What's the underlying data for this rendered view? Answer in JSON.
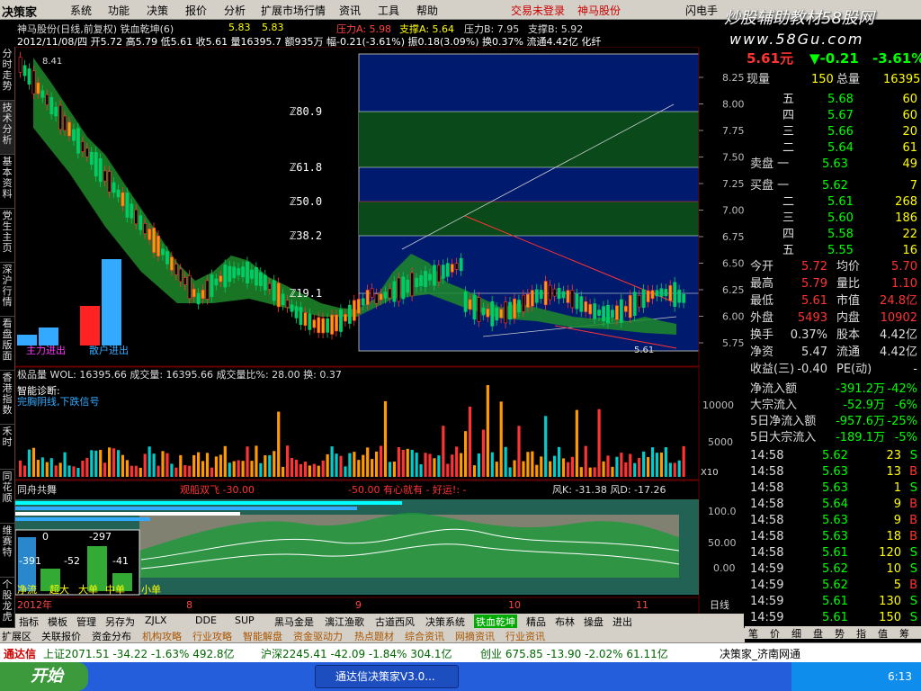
{
  "menubar": {
    "logo": "决策家",
    "items": [
      "系统",
      "功能",
      "决策",
      "报价",
      "分析",
      "扩展市场行情",
      "资讯",
      "工具",
      "帮助"
    ],
    "alert1": "交易未登录",
    "alert2": "神马股份",
    "right": "闪电手"
  },
  "watermark": {
    "line1": "炒股辅助教材58股网",
    "line2": "www.58Gu.com"
  },
  "side_tabs": [
    "分时走势",
    "技术分析",
    "基本资料",
    "党生主页",
    "深沪行情",
    "看盘版面",
    "香港指数",
    "禾时",
    "同花顺",
    "维赛特",
    "个股龙虎"
  ],
  "header": {
    "title": "神马股份(日线,前复权) 铁血乾坤(6)",
    "t1": "5.83",
    "t2": "5.83",
    "pressure": "压力A: 5.98",
    "support": "支撑A: 5.64",
    "pressure2": "压力B: 7.95",
    "support2": "支撑B: 5.92",
    "line2": "2012/11/08/四 开5.72 高5.79 低5.61 收5.61 量16395.7 额935万 幅-0.21(-3.61%) 振0.18(3.09%) 换0.37% 流通4.42亿 化纤"
  },
  "main_chart": {
    "price_top": "8.41",
    "price_last": "5.61",
    "fib": [
      "ℤ80.9",
      "ℤ61.8",
      "ℤ50.0",
      "ℤ38.2",
      "ℤ19.1"
    ],
    "y_ticks": [
      "8.25",
      "8.00",
      "7.75",
      "7.50",
      "7.25",
      "7.00",
      "6.75",
      "6.50",
      "6.25",
      "6.00",
      "5.75"
    ],
    "main_in": "主力进出",
    "retail_in": "散户进出"
  },
  "volume": {
    "label": "极品量 WOL: 16395.66   成交量: 16395.66   成交量比%: 28.00 换: 0.37",
    "label2": "智能诊断:",
    "label3": "完胸阴线,下跌信号",
    "y_ticks": [
      "10000",
      "5000"
    ],
    "x10": "X10"
  },
  "osc": {
    "title": "同舟共舞",
    "mid": "观船双飞 -30.00",
    "mid2": "-50.00  有心就有 - 好运!: -",
    "right": "风K: -31.38 风D: -17.26",
    "y_ticks": [
      "100.0",
      "50.00",
      "0.00"
    ],
    "box_vals": [
      "0",
      "-297",
      "-391",
      "-52",
      "-41"
    ],
    "box_labels": [
      "净流",
      "超大",
      "大单",
      "中单",
      "小单"
    ]
  },
  "x_axis": {
    "labels": [
      "2012年",
      "8",
      "9",
      "10",
      "11"
    ],
    "right": "日线"
  },
  "bottom_tabs": [
    "指标",
    "模板",
    "管理",
    "另存为",
    "ZJLX",
    "DDE",
    "SUP",
    "黑马金是",
    "漓江渔歌",
    "古道西风",
    "决策系统",
    "铁血乾坤",
    "精品",
    "布林",
    "操盘",
    "进出"
  ],
  "tabs2": [
    "扩展区",
    "关联报价",
    "资金分布",
    "机构攻略",
    "行业攻略",
    "智能解盘",
    "资金驱动力",
    "热点题材",
    "综合资讯",
    "网摘资讯",
    "行业资讯"
  ],
  "quote": {
    "price": "5.61元",
    "chg": "▼-0.21",
    "pct": "-3.61%",
    "now_label": "现量",
    "now_val": "150",
    "total_label": "总量",
    "total_val": "16395",
    "asks": [
      [
        "五",
        "5.68",
        "60"
      ],
      [
        "四",
        "5.67",
        "60"
      ],
      [
        "三",
        "5.66",
        "20"
      ],
      [
        "二",
        "5.64",
        "61"
      ],
      [
        "卖盘 一",
        "5.63",
        "49"
      ]
    ],
    "bids": [
      [
        "买盘 一",
        "5.62",
        "7"
      ],
      [
        "二",
        "5.61",
        "268"
      ],
      [
        "三",
        "5.60",
        "186"
      ],
      [
        "四",
        "5.58",
        "22"
      ],
      [
        "五",
        "5.55",
        "16"
      ]
    ],
    "stats": [
      [
        "今开",
        "5.72",
        "均价",
        "5.70"
      ],
      [
        "最高",
        "5.79",
        "量比",
        "1.10"
      ],
      [
        "最低",
        "5.61",
        "市值",
        "24.8亿"
      ],
      [
        "外盘",
        "5493",
        "内盘",
        "10902"
      ],
      [
        "换手",
        "0.37%",
        "股本",
        "4.42亿"
      ],
      [
        "净资",
        "5.47",
        "流通",
        "4.42亿"
      ],
      [
        "收益(三)",
        "-0.40",
        "PE(动)",
        "-"
      ]
    ],
    "flows": [
      [
        "净流入额",
        "-391.2万",
        "-42%"
      ],
      [
        "大宗流入",
        "-52.9万",
        "-6%"
      ],
      [
        "5日净流入额",
        "-957.6万",
        "-25%"
      ],
      [
        "5日大宗流入",
        "-189.1万",
        "-5%"
      ]
    ],
    "ticks": [
      [
        "14:58",
        "5.62",
        "23",
        "S"
      ],
      [
        "14:58",
        "5.63",
        "13",
        "B"
      ],
      [
        "14:58",
        "5.63",
        "1",
        "S"
      ],
      [
        "14:58",
        "5.64",
        "9",
        "B"
      ],
      [
        "14:58",
        "5.63",
        "9",
        "B"
      ],
      [
        "14:58",
        "5.63",
        "18",
        "B"
      ],
      [
        "14:58",
        "5.61",
        "120",
        "S"
      ],
      [
        "14:59",
        "5.62",
        "10",
        "S"
      ],
      [
        "14:59",
        "5.62",
        "5",
        "B"
      ],
      [
        "14:59",
        "5.61",
        "130",
        "S"
      ],
      [
        "14:59",
        "5.61",
        "150",
        "S"
      ]
    ],
    "foot_tabs": [
      "笔",
      "价",
      "细",
      "盘",
      "势",
      "指",
      "值",
      "筹"
    ]
  },
  "ticker": {
    "brand": "通达信",
    "sh": "上证2071.51 -34.22 -1.63% 492.8亿",
    "sz": "沪深2245.41 -42.09 -1.84% 304.1亿",
    "cy": "创业 675.85 -13.90 -2.02% 61.11亿",
    "right": "决策家_济南网通"
  },
  "taskbar": {
    "start": "开始",
    "app": "通达信决策家V3.0...",
    "time": "6:13"
  }
}
